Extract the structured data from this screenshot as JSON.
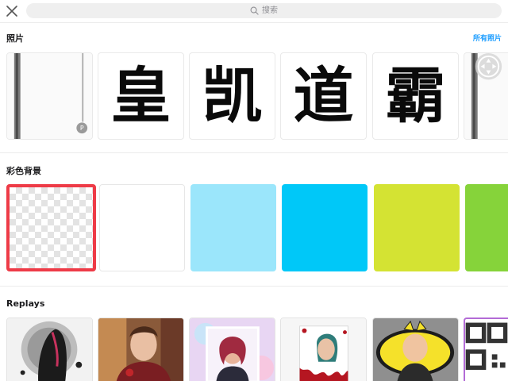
{
  "top_bar": {
    "close_icon": "close-icon",
    "search": {
      "icon": "search-icon",
      "placeholder": "搜索"
    }
  },
  "photos_section": {
    "title": "照片",
    "see_all_label": "所有照片",
    "tiles": [
      {
        "kind": "image",
        "description_icon": "photo-icon"
      },
      {
        "kind": "calligraphy",
        "text": "皇"
      },
      {
        "kind": "calligraphy",
        "text": "凯"
      },
      {
        "kind": "calligraphy",
        "text": "道"
      },
      {
        "kind": "calligraphy",
        "text": "霸"
      },
      {
        "kind": "image",
        "description_icon": "photo-icon"
      }
    ]
  },
  "color_backgrounds_section": {
    "title": "彩色背景",
    "swatches": [
      {
        "name": "transparent",
        "color": "transparent",
        "selected": true
      },
      {
        "name": "white",
        "color": "#ffffff",
        "selected": false
      },
      {
        "name": "light-blue",
        "color": "#9be6fb",
        "selected": false
      },
      {
        "name": "cyan",
        "color": "#00c8f8",
        "selected": false
      },
      {
        "name": "lime",
        "color": "#d4e333",
        "selected": false
      },
      {
        "name": "green",
        "color": "#86d33a",
        "selected": false
      }
    ],
    "selected_border_color": "#ee3b47"
  },
  "replays_section": {
    "title": "Replays",
    "thumbnails": [
      {
        "icon": "replay-thumbnail"
      },
      {
        "icon": "replay-thumbnail"
      },
      {
        "icon": "replay-thumbnail"
      },
      {
        "icon": "replay-thumbnail"
      },
      {
        "icon": "replay-thumbnail"
      },
      {
        "icon": "qr-code-icon"
      }
    ]
  }
}
